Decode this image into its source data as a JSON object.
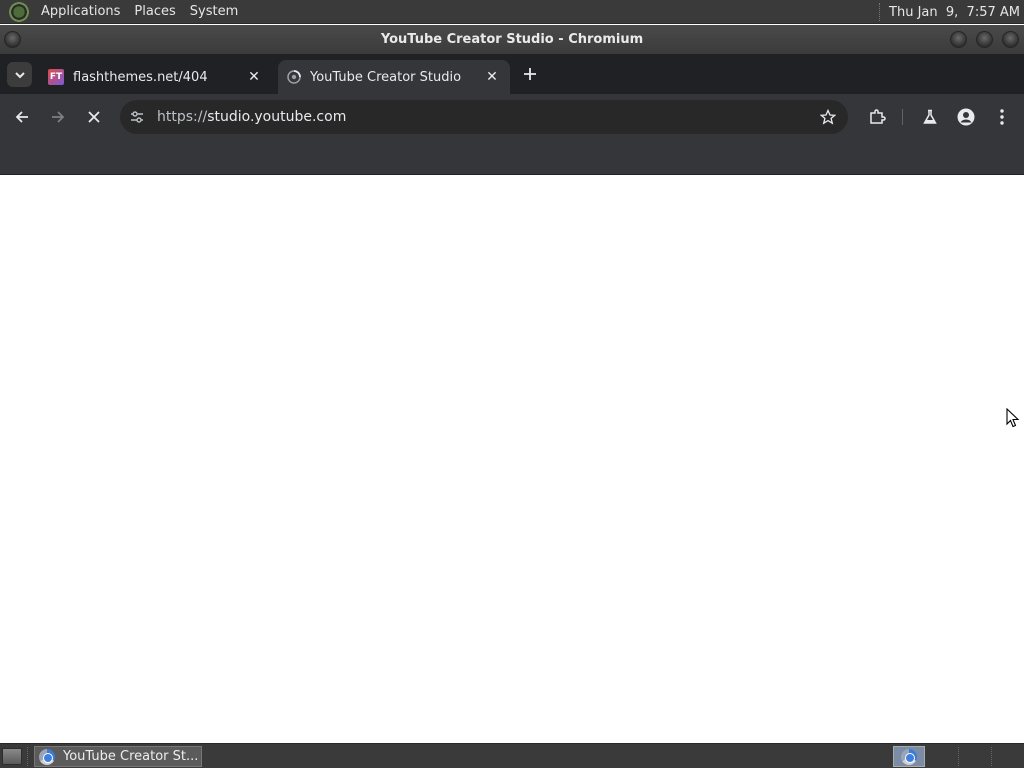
{
  "top_panel": {
    "menus": [
      "Applications",
      "Places",
      "System"
    ],
    "clock": "Thu Jan  9,  7:57 AM"
  },
  "window": {
    "title": "YouTube Creator Studio - Chromium"
  },
  "tabs": [
    {
      "label": "flashthemes.net/404",
      "favicon": "FT",
      "active": false
    },
    {
      "label": "YouTube Creator Studio",
      "favicon": "loading-spinner-icon",
      "active": true
    }
  ],
  "toolbar": {
    "url_scheme": "https://",
    "url_host": "studio.youtube.com",
    "loading": true
  },
  "taskbar": {
    "task_label": "YouTube Creator St..."
  },
  "colors": {
    "panel_bg": "#3a3a3a",
    "tabstrip_bg": "#202124",
    "toolbar_bg": "#35363a",
    "content_bg": "#ffffff"
  }
}
